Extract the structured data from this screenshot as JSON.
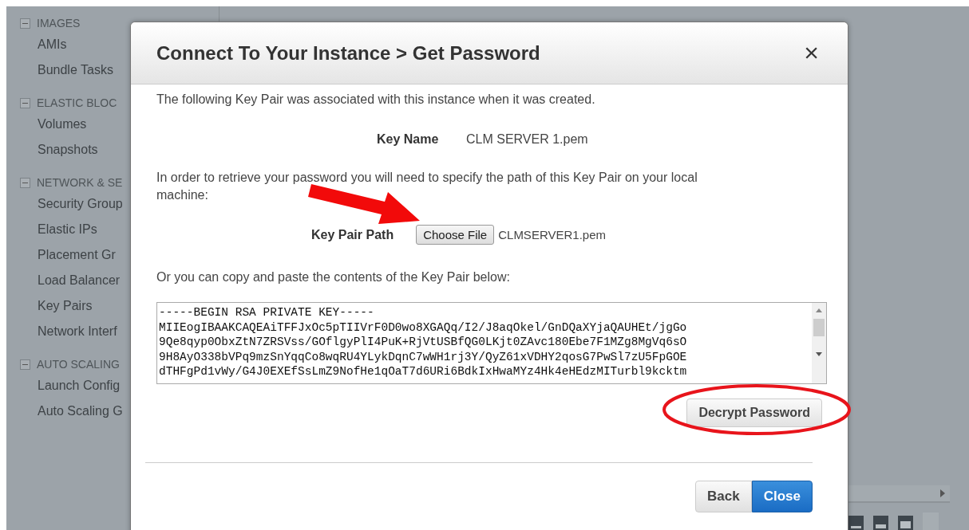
{
  "sidebar": {
    "sections": [
      {
        "title": "IMAGES",
        "expanded": true,
        "items": [
          "AMIs",
          "Bundle Tasks"
        ]
      },
      {
        "title": "ELASTIC BLOC",
        "expanded": true,
        "items": [
          "Volumes",
          "Snapshots"
        ]
      },
      {
        "title": "NETWORK & SE",
        "expanded": true,
        "items": [
          "Security Group",
          "Elastic IPs",
          "Placement Gr",
          "Load Balancer",
          "Key Pairs",
          "Network Interf"
        ]
      },
      {
        "title": "AUTO SCALING",
        "expanded": true,
        "items": [
          "Launch Config",
          "Auto Scaling G"
        ]
      }
    ]
  },
  "dialog": {
    "title": "Connect To Your Instance > Get Password",
    "close": "×",
    "intro": "The following Key Pair was associated with this instance when it was created.",
    "key_name_label": "Key Name",
    "key_name": "CLM SERVER 1.pem",
    "path_instruction": "In order to retrieve your password you will need to specify the path of this Key Pair on your local machine:",
    "key_path_label": "Key Pair Path",
    "choose_file": "Choose File",
    "chosen_file": "CLMSERVER1.pem",
    "paste_instruction": "Or you can copy and paste the contents of the Key Pair below:",
    "key_contents": [
      "-----BEGIN RSA PRIVATE KEY-----",
      "MIIEogIBAAKCAQEAiTFFJxOc5pTIIVrF0D0wo8XGAQq/I2/J8aqOkel/GnDQaXYjaQAUHEt/jgGo",
      "9Qe8qyp0ObxZtN7ZRSVss/GOflgyPlI4PuK+RjVtUSBfQG0LKjt0ZAvc180Ebe7F1MZg8MgVq6sO",
      "9H8AyO338bVPq9mzSnYqqCo8wqRU4YLykDqnC7wWH1rj3Y/QyZ61xVDHY2qosG7PwSl7zU5FpGOE",
      "dTHFgPd1vWy/G4J0EXEfSsLmZ9NofHe1qOaT7d6URi6BdkIxHwaMYz4Hk4eHEdzMITurbl9kcktm"
    ],
    "decrypt_button": "Decrypt Password",
    "buttons": [
      {
        "label": "Back",
        "kind": "secondary"
      },
      {
        "label": "Close",
        "kind": "primary"
      }
    ]
  }
}
